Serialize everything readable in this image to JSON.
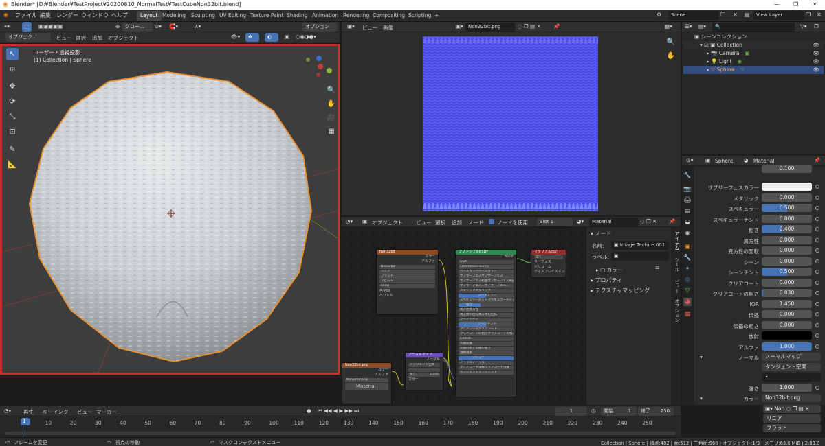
{
  "window": {
    "title": "Blender* [D:¥Blender¥TestProject¥20200810_NormalTest¥TestCubeNon32bit.blend]"
  },
  "menu": [
    "ファイル",
    "編集",
    "レンダー",
    "ウィンドウ",
    "ヘルプ"
  ],
  "workspaces": [
    "Layout",
    "Modeling",
    "Sculpting",
    "UV Editing",
    "Texture Paint",
    "Shading",
    "Animation",
    "Rendering",
    "Compositing",
    "Scripting",
    "+"
  ],
  "scene": {
    "label": "Scene",
    "view_layer": "View Layer"
  },
  "viewport": {
    "mode": "オブジェク…",
    "menus": [
      "ビュー",
      "選択",
      "追加",
      "オブジェクト"
    ],
    "transform": "グロー…",
    "options": "オプション",
    "info_line1": "ユーザー・透視投影",
    "info_line2": "(1) Collection | Sphere"
  },
  "image_editor": {
    "menus": [
      "ビュー",
      "画像"
    ],
    "image_name": "Non32bit.png"
  },
  "node_editor": {
    "mode": "オブジェクト",
    "menus": [
      "ビュー",
      "選択",
      "追加",
      "ノード"
    ],
    "use_nodes": "ノードを使用",
    "slot": "Slot 1",
    "material": "Material",
    "panel": {
      "section": "ノード",
      "name_label": "名前:",
      "name_value": "Image Texture.001",
      "label_label": "ラベル:",
      "color_label": "カラー",
      "props": "プロパティ",
      "texmap": "テクスチャマッピング"
    },
    "tabs": [
      "アイテム",
      "ツール",
      "ビュー",
      "オプション"
    ],
    "nodes": {
      "imgtex": {
        "title": "Non32bit",
        "out1": "カラー",
        "out2": "アルファ",
        "img": "Non32bit",
        "f1": "リニア",
        "f2": "フラット",
        "f3": "リピート",
        "f4": "sRGB",
        "colorspace": "色空間",
        "vector": "ベクトル"
      },
      "bsdf": {
        "title": "プリンシプルBSDF",
        "out": "BSDF",
        "f1": "GGX",
        "f2": "Christensen-Burley",
        "rows": [
          "ベースカラー",
          "サブサーフェス",
          "サブサーフェス範囲",
          "サブサーフェス…",
          "メタリック",
          "スペキュラー",
          "スペキュラーチント",
          "粗さ",
          "異方性",
          "異方性の回転",
          "シーン",
          "シーンチント",
          "クリアコート",
          "クリアコートの粗さ",
          "IOR",
          "伝播",
          "伝播の粗さ",
          "放射",
          "アルファ",
          "ノーマル",
          "クリアコート法線",
          "タンジェント"
        ]
      },
      "output": {
        "title": "マテリアル出力",
        "f1": "全て",
        "rows": [
          "サーフェス",
          "ボリューム",
          "ディスプレイスメント"
        ]
      },
      "normalmap": {
        "title": "ノーマルマップ",
        "out": "ノーマル",
        "f1": "タンジェント空間",
        "strength": "強さ",
        "strength_val": "1.000",
        "color": "カラー"
      },
      "imgtex2": {
        "title": "Non32bit.png",
        "out1": "カラー",
        "out2": "アルファ",
        "img": "Non32bit.png"
      }
    },
    "bottom_material": "Material"
  },
  "outliner": {
    "title": "シーンコレクション",
    "items": [
      {
        "label": "Collection"
      },
      {
        "label": "Camera"
      },
      {
        "label": "Light"
      },
      {
        "label": "Sphere"
      }
    ]
  },
  "properties": {
    "object": "Sphere",
    "material": "Material",
    "top_val": "0.100",
    "rows": [
      {
        "label": "サブサーフェスカラー",
        "value": "",
        "type": "color_white"
      },
      {
        "label": "メタリック",
        "value": "0.000",
        "fill": 0
      },
      {
        "label": "スペキュラー",
        "value": "0.500",
        "fill": 0.5
      },
      {
        "label": "スペキュラーチント",
        "value": "0.000",
        "fill": 0
      },
      {
        "label": "粗さ",
        "value": "0.400",
        "fill": 0.4
      },
      {
        "label": "異方性",
        "value": "0.000",
        "fill": 0
      },
      {
        "label": "異方性の回転",
        "value": "0.000",
        "fill": 0
      },
      {
        "label": "シーン",
        "value": "0.000",
        "fill": 0
      },
      {
        "label": "シーンチント",
        "value": "0.500",
        "fill": 0.5
      },
      {
        "label": "クリアコート",
        "value": "0.000",
        "fill": 0
      },
      {
        "label": "クリアコートの粗さ",
        "value": "0.030",
        "fill": 0.03
      },
      {
        "label": "IOR",
        "value": "1.450",
        "fill": 0
      },
      {
        "label": "伝播",
        "value": "0.000",
        "fill": 0
      },
      {
        "label": "伝播の粗さ",
        "value": "0.000",
        "fill": 0
      },
      {
        "label": "放射",
        "value": "",
        "type": "color_black"
      },
      {
        "label": "アルファ",
        "value": "1.000",
        "fill": 1
      }
    ],
    "normal_label": "ノーマル",
    "normal_value": "ノーマルマップ",
    "tangent": "タンジェント空間",
    "strength_label": "強さ",
    "strength_value": "1.000",
    "color_label": "カラー",
    "color_value": "Non32bit.png",
    "img_name": "Non",
    "interp": "リニア",
    "proj": "フラット"
  },
  "timeline": {
    "menus": [
      "再生",
      "キーイング",
      "ビュー",
      "マーカー"
    ],
    "current": "1",
    "start_label": "開始",
    "start": "1",
    "end_label": "終了",
    "end": "250",
    "ticks": [
      "1",
      "10",
      "20",
      "30",
      "40",
      "50",
      "60",
      "70",
      "80",
      "90",
      "100",
      "110",
      "120",
      "130",
      "140",
      "150",
      "160",
      "170",
      "180",
      "190",
      "200",
      "210",
      "220",
      "230",
      "240",
      "250"
    ]
  },
  "status": {
    "left1": "フレームを変更",
    "left2": "視点の移動",
    "left3": "マスクコンテクストメニュー",
    "right": "Collection | Sphere | 頂点:482 | 面:512 | 三角面:960 | オブジェクト:1/3 | メモリ:63.6 MiB | 2.83.0"
  }
}
